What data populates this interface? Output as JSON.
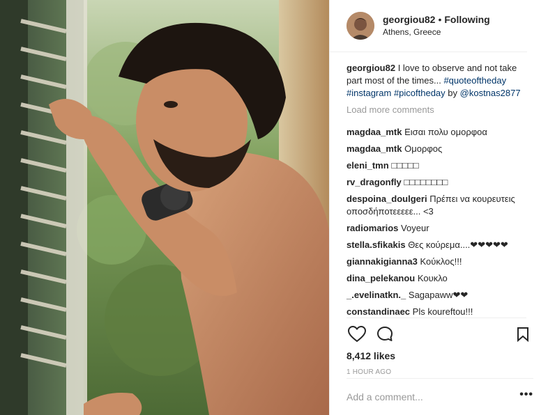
{
  "header": {
    "username": "georgiou82",
    "separator": "•",
    "follow_status": "Following",
    "location": "Athens, Greece"
  },
  "caption": {
    "username": "georgiou82",
    "text": " I love to observe and not take part most of the times... ",
    "hashtags": [
      "#quoteoftheday",
      "#instagram",
      "#picoftheday"
    ],
    "by_text": " by ",
    "mention": "@kostnas2877"
  },
  "load_more": "Load more comments",
  "comments": [
    {
      "user": "magdaa_mtk",
      "text": "Εισαι πολυ ομορφοα"
    },
    {
      "user": "magdaa_mtk",
      "text": "Ομορφος"
    },
    {
      "user": "eleni_tmn",
      "text": "□□□□□"
    },
    {
      "user": "rv_dragonfly",
      "text": "□□□□□□□□"
    },
    {
      "user": "despoina_doulgeri",
      "text": "Πρέπει να κουρευτεις οποσδήποτεεεεε... <3"
    },
    {
      "user": "radiomarios",
      "text": "Voyeur"
    },
    {
      "user": "stella.sfikakis",
      "text": "Θες κούρεμα....❤❤❤❤❤"
    },
    {
      "user": "giannakigianna3",
      "text": "Κούκλος!!!"
    },
    {
      "user": "dina_pelekanou",
      "text": "Κουκλο"
    },
    {
      "user": "_.evelinatkn._",
      "text": "Sagapaww❤❤"
    },
    {
      "user": "constandinaec",
      "text": "Pls koureftou!!!"
    }
  ],
  "icons": {
    "like": "heart-icon",
    "comment": "comment-bubble-icon",
    "save": "bookmark-icon"
  },
  "likes": "8,412 likes",
  "timestamp": "1 HOUR AGO",
  "add_comment_placeholder": "Add a comment...",
  "more_options": "•••",
  "colors": {
    "link": "#003569",
    "muted": "#999999",
    "text": "#262626",
    "border": "#efefef"
  }
}
